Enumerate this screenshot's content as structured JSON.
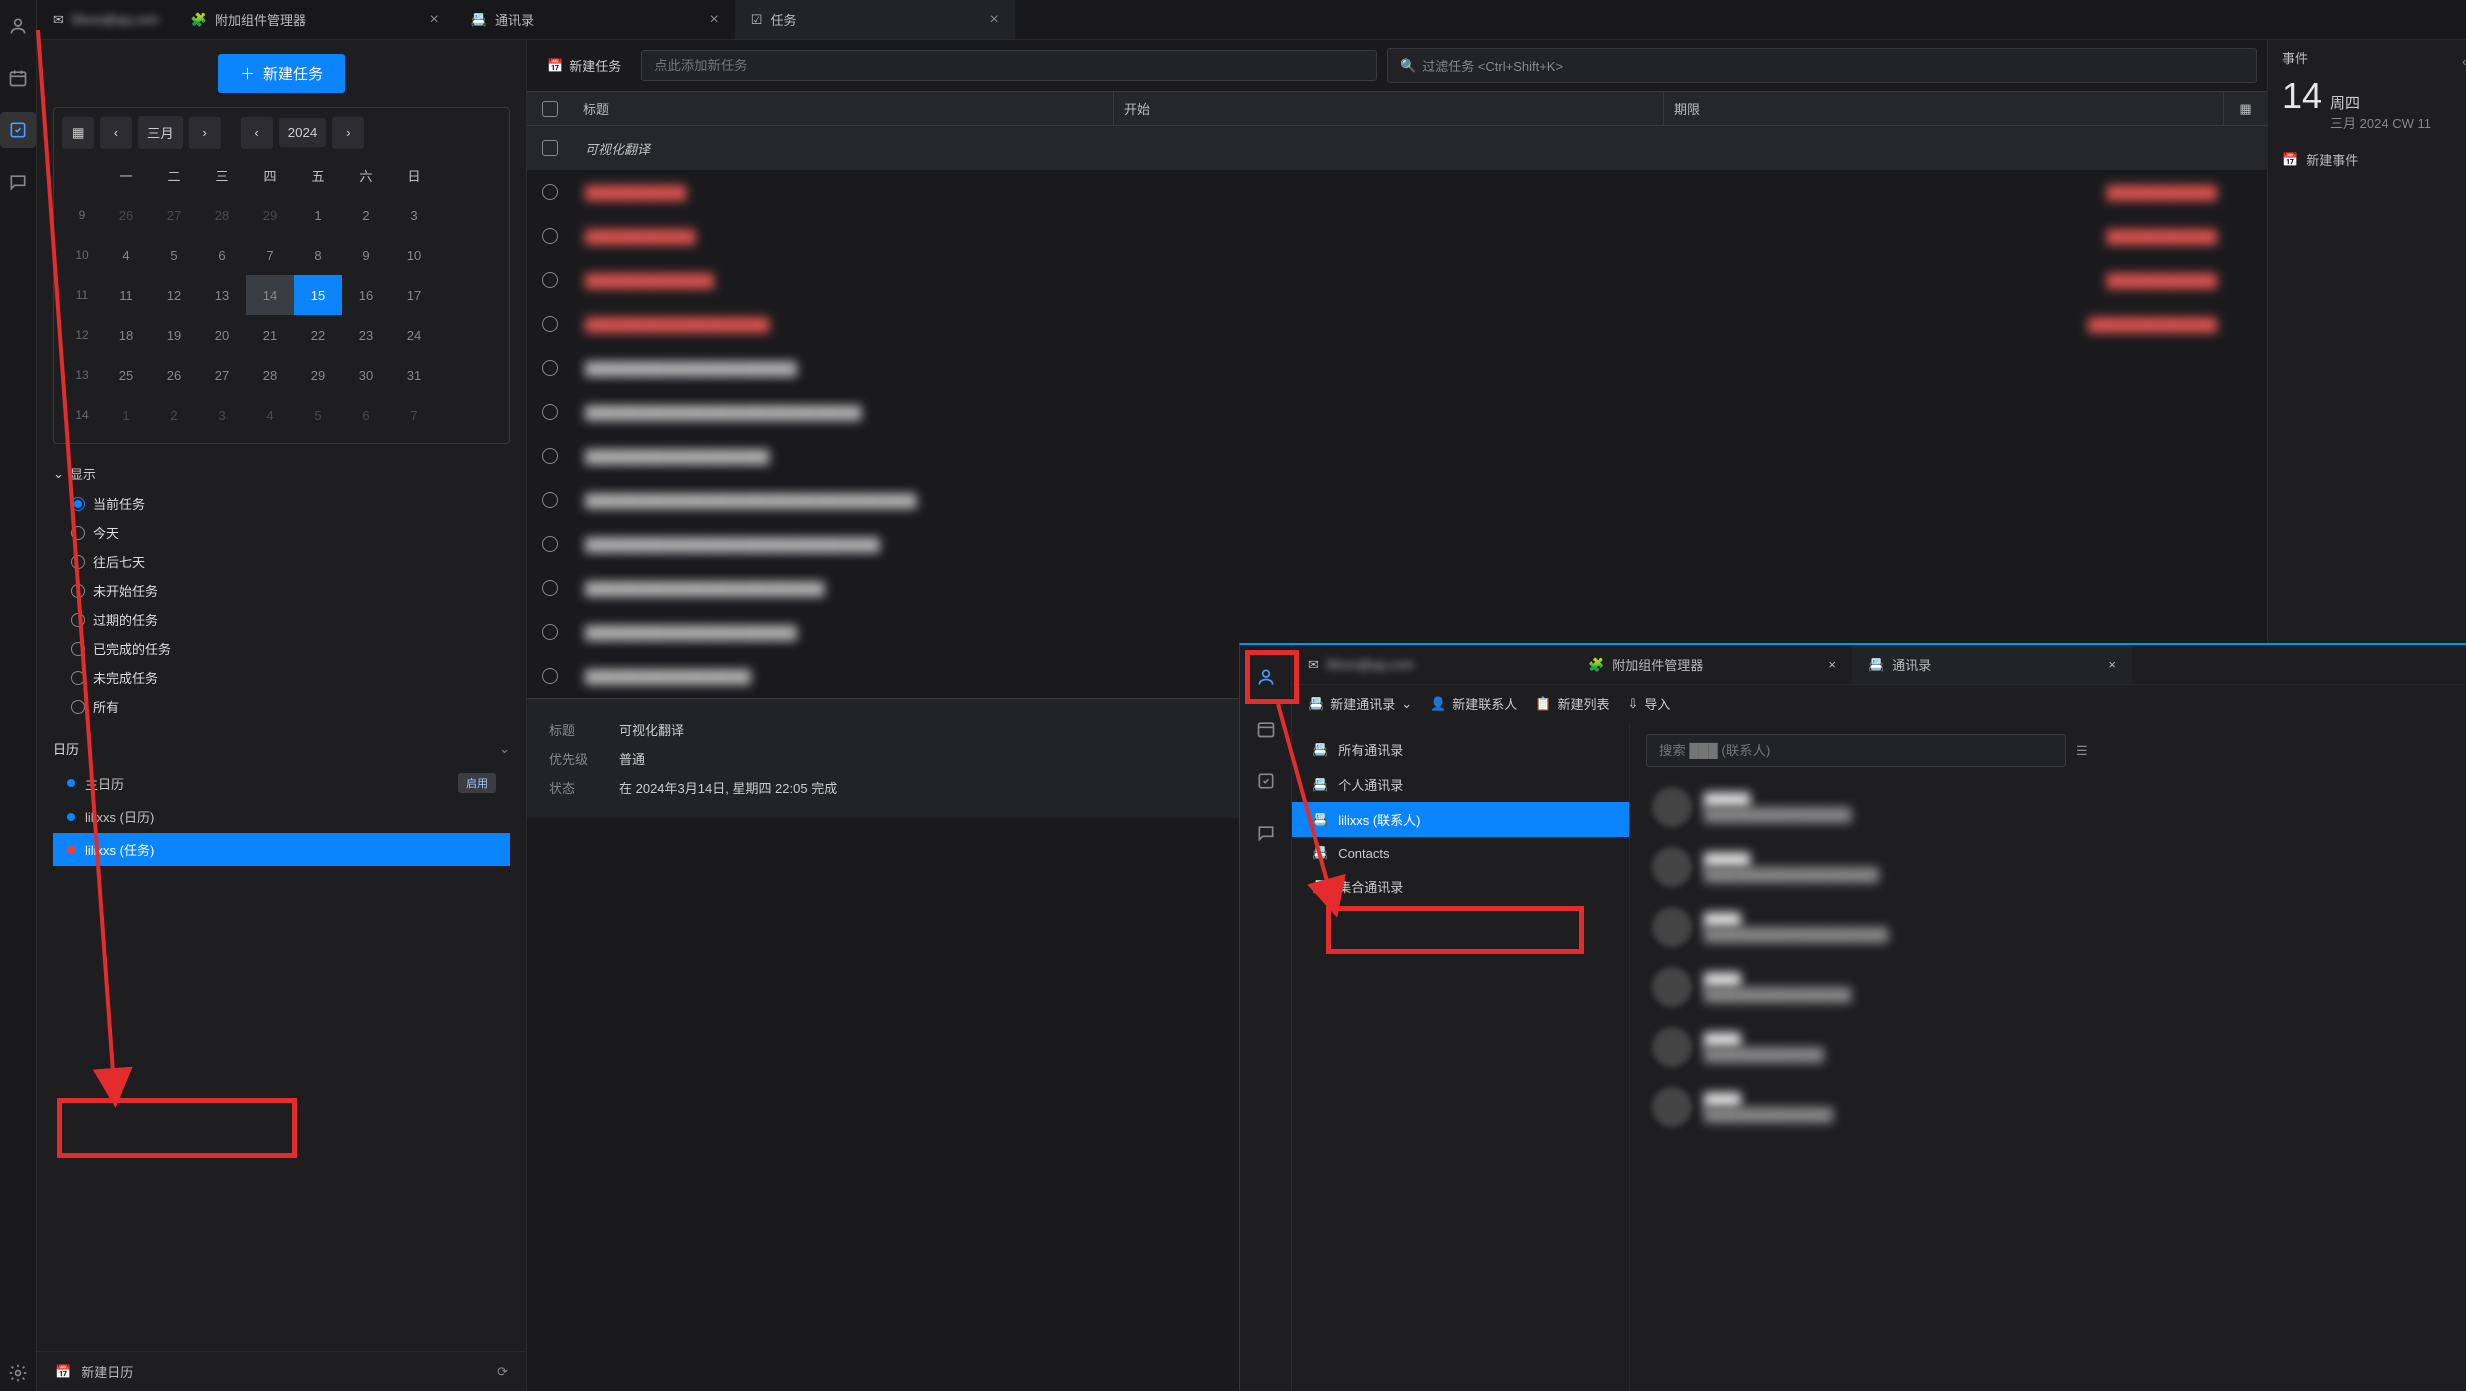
{
  "tabs": {
    "mail_label": "lilixxs@qq.com",
    "addons_label": "附加组件管理器",
    "addressbook_label": "通讯录",
    "tasks_label": "任务"
  },
  "sidebar": {
    "new_task_btn": "新建任务",
    "month": "三月",
    "year": "2024",
    "dow": [
      "一",
      "二",
      "三",
      "四",
      "五",
      "六",
      "日"
    ],
    "weeks": [
      {
        "wk": "9",
        "days": [
          "26",
          "27",
          "28",
          "29",
          "1",
          "2",
          "3"
        ],
        "other": [
          0,
          1,
          2,
          3
        ]
      },
      {
        "wk": "10",
        "days": [
          "4",
          "5",
          "6",
          "7",
          "8",
          "9",
          "10"
        ]
      },
      {
        "wk": "11",
        "days": [
          "11",
          "12",
          "13",
          "14",
          "15",
          "16",
          "17"
        ],
        "today": 3,
        "sel": 4
      },
      {
        "wk": "12",
        "days": [
          "18",
          "19",
          "20",
          "21",
          "22",
          "23",
          "24"
        ]
      },
      {
        "wk": "13",
        "days": [
          "25",
          "26",
          "27",
          "28",
          "29",
          "30",
          "31"
        ]
      },
      {
        "wk": "14",
        "days": [
          "1",
          "2",
          "3",
          "4",
          "5",
          "6",
          "7"
        ],
        "other": [
          0,
          1,
          2,
          3,
          4,
          5,
          6
        ]
      }
    ],
    "display_label": "显示",
    "filters": [
      {
        "label": "当前任务",
        "checked": true
      },
      {
        "label": "今天"
      },
      {
        "label": "往后七天"
      },
      {
        "label": "未开始任务"
      },
      {
        "label": "过期的任务"
      },
      {
        "label": "已完成的任务"
      },
      {
        "label": "未完成任务"
      },
      {
        "label": "所有"
      }
    ],
    "calendar_label": "日历",
    "cal_items": [
      {
        "label": "主日历",
        "color": "#0a84ff",
        "badge": "启用"
      },
      {
        "label": "lilixxs (日历)",
        "color": "#0a84ff"
      },
      {
        "label": "lilixxs (任务)",
        "color": "#ff3b30",
        "selected": true
      }
    ],
    "new_cal_label": "新建日历"
  },
  "tasks": {
    "new_task": "新建任务",
    "add_placeholder": "点此添加新任务",
    "filter_placeholder": "过滤任务 <Ctrl+Shift+K>",
    "col_title": "标题",
    "col_start": "开始",
    "col_due": "期限",
    "group": "可视化翻译",
    "rows": [
      {
        "title": "███████████",
        "due": "████████████",
        "red": true
      },
      {
        "title": "████████████",
        "due": "████████████",
        "red": true
      },
      {
        "title": "██████████████",
        "due": "████████████",
        "red": true
      },
      {
        "title": "████████████████████",
        "due": "██████████████",
        "red": true
      },
      {
        "title": "███████████████████████"
      },
      {
        "title": "██████████████████████████████"
      },
      {
        "title": "████████████████████"
      },
      {
        "title": "████████████████████████████████████"
      },
      {
        "title": "████████████████████████████████"
      },
      {
        "title": "██████████████████████████"
      },
      {
        "title": "███████████████████████"
      },
      {
        "title": "██████████████████"
      }
    ],
    "detail": {
      "title_label": "标题",
      "title_val": "可视化翻译",
      "prio_label": "优先级",
      "prio_val": "普通",
      "state_label": "状态",
      "state_val": "在 2024年3月14日, 星期四 22:05 完成"
    }
  },
  "rightpanel": {
    "events_label": "事件",
    "day": "14",
    "weekday": "周四",
    "sub": "三月 2024  CW 11",
    "new_event": "新建事件"
  },
  "overlay": {
    "mail_tab": "lilixxs@qq.com",
    "addons_tab": "附加组件管理器",
    "ab_tab": "通讯录",
    "toolbar": {
      "new_ab": "新建通讯录",
      "new_contact": "新建联系人",
      "new_list": "新建列表",
      "import": "导入"
    },
    "tree": [
      {
        "label": "所有通讯录"
      },
      {
        "label": "个人通讯录"
      },
      {
        "label": "lilixxs (联系人)",
        "selected": true
      },
      {
        "label": "Contacts"
      },
      {
        "label": "集合通讯录"
      }
    ],
    "search_placeholder": "搜索 ███ (联系人)",
    "contacts": [
      {
        "name": "█████",
        "email": "████████████████"
      },
      {
        "name": "█████",
        "email": "███████████████████"
      },
      {
        "name": "████",
        "email": "████████████████████"
      },
      {
        "name": "████",
        "email": "████████████████"
      },
      {
        "name": "████",
        "email": "█████████████"
      },
      {
        "name": "████",
        "email": "██████████████"
      }
    ]
  }
}
